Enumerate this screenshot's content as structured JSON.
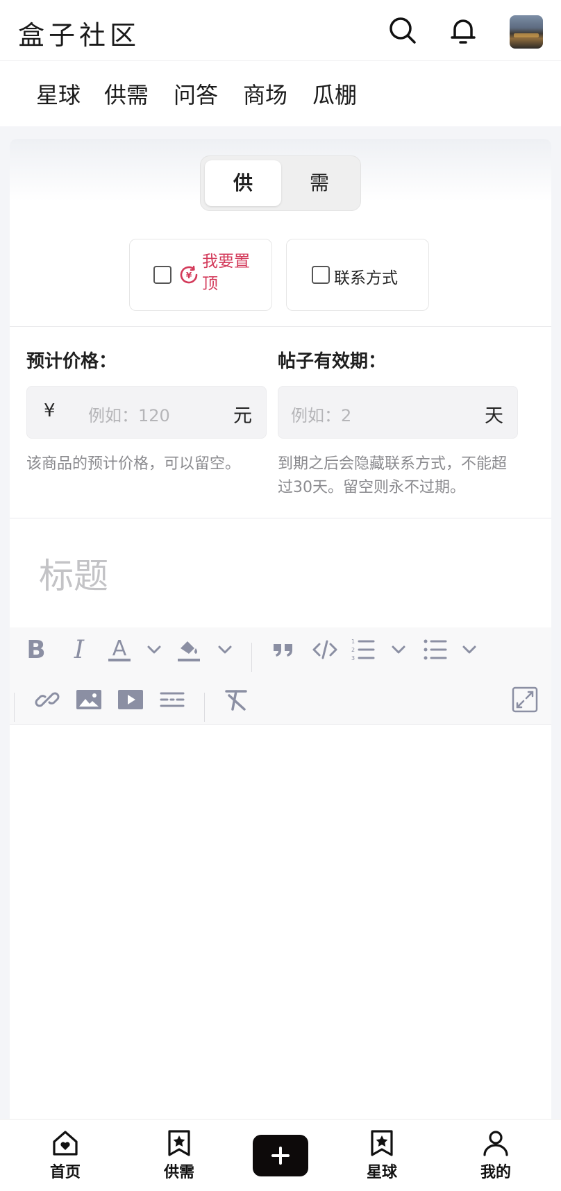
{
  "header": {
    "brand": "盒子社区",
    "icons": [
      "search-icon",
      "bell-icon"
    ],
    "avatar": "user-avatar"
  },
  "categories": [
    "星球",
    "供需",
    "问答",
    "商场",
    "瓜棚"
  ],
  "form": {
    "type_toggle": {
      "supply": "供",
      "demand": "需",
      "selected": "供"
    },
    "pin_option": {
      "label": "我要置顶",
      "checked": false,
      "icon": "yuan-coin-icon"
    },
    "contact_option": {
      "label": "联系方式",
      "checked": false
    },
    "price": {
      "label": "预计价格：",
      "prefix": "¥",
      "placeholder": "例如：120",
      "suffix": "元",
      "value": "",
      "help": "该商品的预计价格，可以留空。"
    },
    "validity": {
      "label": "帖子有效期：",
      "placeholder": "例如：2",
      "suffix": "天",
      "value": "",
      "help": "到期之后会隐藏联系方式，不能超过30天。留空则永不过期。"
    },
    "title_placeholder": "标题",
    "toolbar_icons": [
      "bold-icon",
      "italic-icon",
      "font-color-icon",
      "highlight-icon",
      "quote-icon",
      "code-icon",
      "ordered-list-icon",
      "bullet-list-icon",
      "link-icon",
      "image-icon",
      "video-icon",
      "horizontal-rule-icon",
      "clear-format-icon",
      "fullscreen-icon"
    ]
  },
  "bottom_nav": {
    "home": "首页",
    "supply": "供需",
    "planet": "星球",
    "mine": "我的",
    "create_icon": "plus-icon"
  },
  "colors": {
    "accent_red": "#d33a5a",
    "icon_gray": "#8b8fa3",
    "create_button": "#0d0a0a"
  }
}
